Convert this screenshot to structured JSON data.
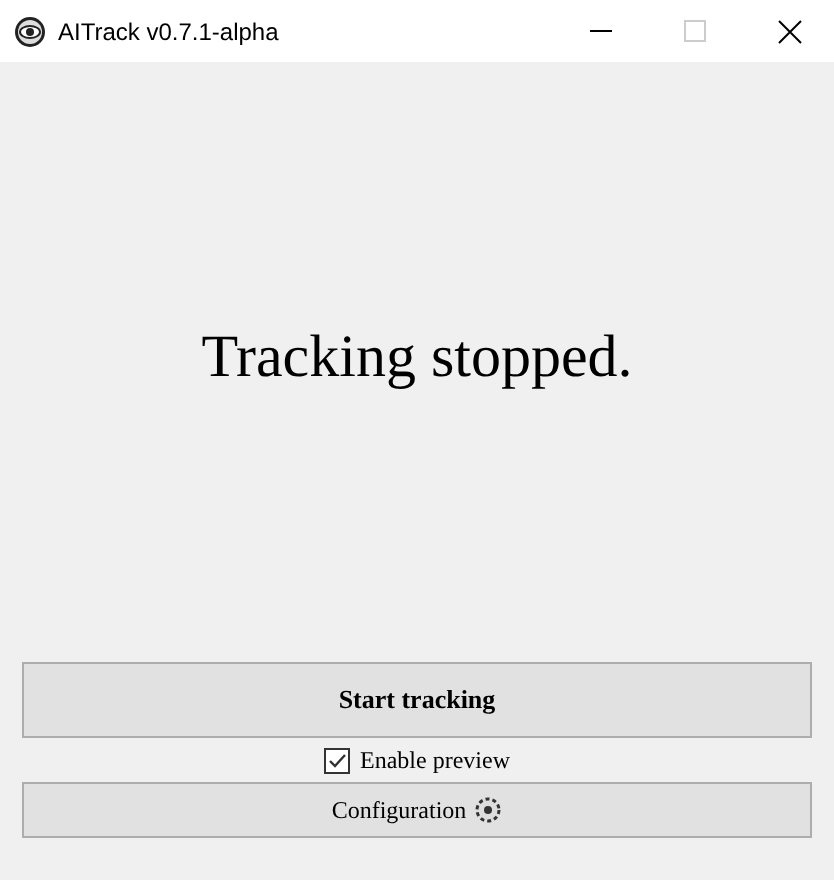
{
  "window": {
    "title": "AITrack v0.7.1-alpha"
  },
  "status": {
    "text": "Tracking stopped."
  },
  "start_button": {
    "label": "Start tracking"
  },
  "preview_checkbox": {
    "label": "Enable preview",
    "checked": true
  },
  "config_button": {
    "label": "Configuration"
  }
}
